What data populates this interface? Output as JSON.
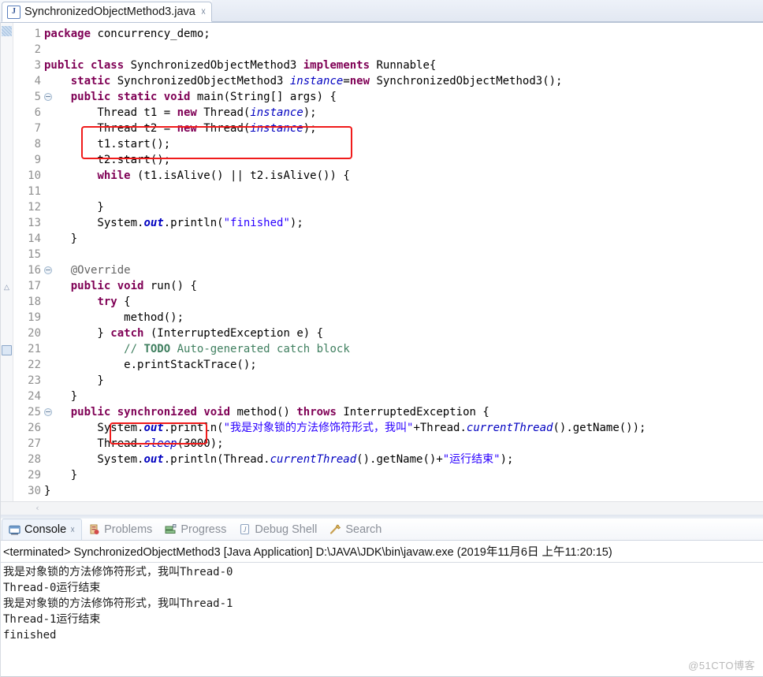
{
  "window": {
    "watermark": "@51CTO博客"
  },
  "editor_tab": {
    "icon": "java-file-icon",
    "title": "SynchronizedObjectMethod3.java",
    "close_glyph": "✂"
  },
  "gutter": {
    "lines": [
      1,
      2,
      3,
      4,
      5,
      6,
      7,
      8,
      9,
      10,
      11,
      12,
      13,
      14,
      15,
      16,
      17,
      18,
      19,
      20,
      21,
      22,
      23,
      24,
      25,
      26,
      27,
      28,
      29,
      30
    ],
    "fold_lines": [
      5,
      16,
      25
    ],
    "override_marker_line": 17,
    "todo_marker_line": 21
  },
  "code": {
    "lines": [
      "package concurrency_demo;",
      "",
      "public class SynchronizedObjectMethod3 implements Runnable{",
      "    static SynchronizedObjectMethod3 instance=new SynchronizedObjectMethod3();",
      "    public static void main(String[] args) {",
      "        Thread t1 = new Thread(instance);",
      "        Thread t2 = new Thread(instance);",
      "        t1.start();",
      "        t2.start();",
      "        while (t1.isAlive() || t2.isAlive()) {",
      "",
      "        }",
      "        System.out.println(\"finished\");",
      "    }",
      "",
      "    @Override",
      "    public void run() {",
      "        try {",
      "            method();",
      "        } catch (InterruptedException e) {",
      "            // TODO Auto-generated catch block",
      "            e.printStackTrace();",
      "        }",
      "    }",
      "    public synchronized void method() throws InterruptedException {",
      "        System.out.println(\"我是对象锁的方法修饰符形式，我叫\"+Thread.currentThread().getName());",
      "        Thread.sleep(3000);",
      "        System.out.println(Thread.currentThread().getName()+\"运行结束\");",
      "    }",
      "}"
    ]
  },
  "highlights": [
    {
      "name": "thread-creation-highlight",
      "lines": [
        6,
        7
      ],
      "color": "#f01b1b"
    },
    {
      "name": "synchronized-keyword-highlight",
      "lines": [
        25
      ],
      "color": "#f01b1b"
    }
  ],
  "view_tabs": [
    {
      "label": "Console",
      "icon": "console-icon",
      "active": true,
      "closeable": true
    },
    {
      "label": "Problems",
      "icon": "problems-icon",
      "active": false,
      "closeable": false
    },
    {
      "label": "Progress",
      "icon": "progress-icon",
      "active": false,
      "closeable": false
    },
    {
      "label": "Debug Shell",
      "icon": "debug-shell-icon",
      "active": false,
      "closeable": false
    },
    {
      "label": "Search",
      "icon": "search-icon",
      "active": false,
      "closeable": false
    }
  ],
  "console": {
    "header": "<terminated> SynchronizedObjectMethod3 [Java Application] D:\\JAVA\\JDK\\bin\\javaw.exe (2019年11月6日 上午11:20:15)",
    "output": "我是对象锁的方法修饰符形式，我叫Thread-0\nThread-0运行结束\n我是对象锁的方法修饰符形式，我叫Thread-1\nThread-1运行结束\nfinished"
  },
  "scrollbar": {
    "left_arrow": "‹"
  },
  "colors": {
    "keyword": "#7f0055",
    "string": "#2a00ff",
    "comment": "#3f7f5f",
    "field": "#0000c0",
    "highlight": "#f01b1b"
  }
}
